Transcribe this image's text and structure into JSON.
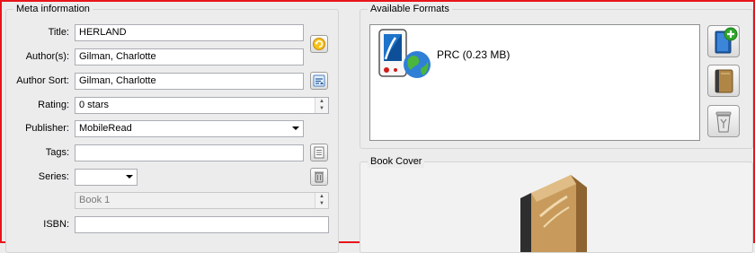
{
  "meta_group": {
    "title": "Meta information",
    "labels": {
      "title": "Title:",
      "authors": "Author(s):",
      "author_sort": "Author Sort:",
      "rating": "Rating:",
      "publisher": "Publisher:",
      "tags": "Tags:",
      "series": "Series:",
      "isbn": "ISBN:"
    },
    "values": {
      "title": "HERLAND",
      "authors": "Gilman, Charlotte",
      "author_sort": "Gilman, Charlotte",
      "rating": "0 stars",
      "publisher": "MobileRead",
      "tags": "",
      "series": "",
      "series_index": "Book 1",
      "isbn": ""
    }
  },
  "formats_group": {
    "title": "Available Formats",
    "items": [
      {
        "label": "PRC (0.23 MB)",
        "icon": "ebook-reader-globe-icon"
      }
    ],
    "buttons": [
      "add-format-icon",
      "book-icon",
      "recycle-bin-icon"
    ]
  },
  "cover_group": {
    "title": "Book Cover",
    "icon": "book-cover-icon"
  },
  "colors": {
    "frame": "#e8141c",
    "window_bg": "#ececec",
    "field_border": "#abadb3"
  }
}
